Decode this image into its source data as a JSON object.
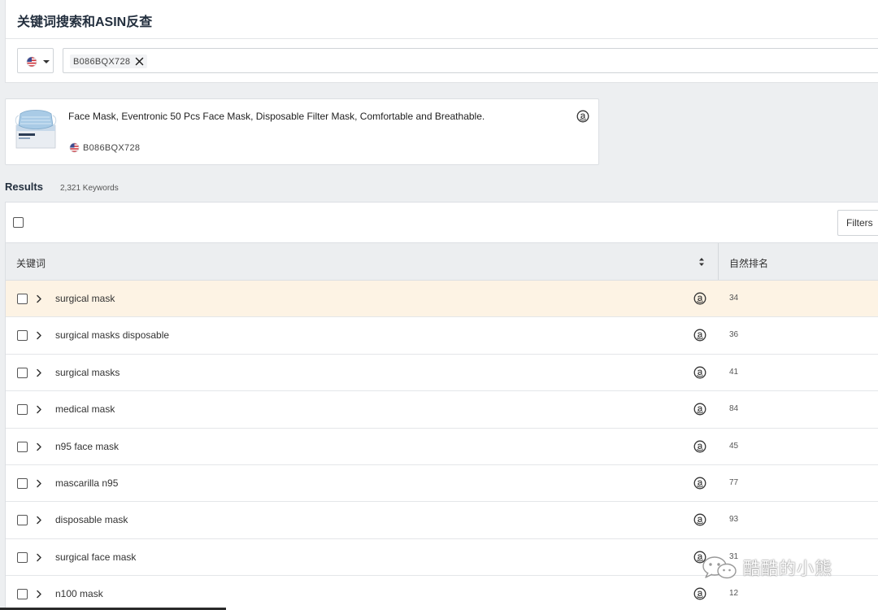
{
  "header": {
    "title": "关键词搜索和ASIN反查"
  },
  "search": {
    "marketplace_flag": "us-flag-icon",
    "asin_chip": "B086BQX728"
  },
  "product": {
    "title": "Face Mask, Eventronic 50 Pcs Face Mask, Disposable Filter Mask, Comfortable and Breathable.",
    "asin": "B086BQX728",
    "icon": "amazon-icon"
  },
  "results": {
    "heading": "Results",
    "count": "2,321 Keywords",
    "filters_label": "Filters",
    "columns": {
      "keyword": "关键词",
      "organic_rank": "自然排名"
    },
    "rows": [
      {
        "keyword": "surgical mask",
        "rank": "34"
      },
      {
        "keyword": "surgical masks disposable",
        "rank": "36"
      },
      {
        "keyword": "surgical masks",
        "rank": "41"
      },
      {
        "keyword": "medical mask",
        "rank": "84"
      },
      {
        "keyword": "n95 face mask",
        "rank": "45"
      },
      {
        "keyword": "mascarilla n95",
        "rank": "77"
      },
      {
        "keyword": "disposable mask",
        "rank": "93"
      },
      {
        "keyword": "surgical face mask",
        "rank": "31"
      },
      {
        "keyword": "n100 mask",
        "rank": "12"
      }
    ]
  },
  "watermark": {
    "text": "酷酷的小熊"
  },
  "colors": {
    "highlight_row": "#fdf3e4",
    "header_bg": "#eceef0",
    "page_bg": "#edeff1"
  }
}
